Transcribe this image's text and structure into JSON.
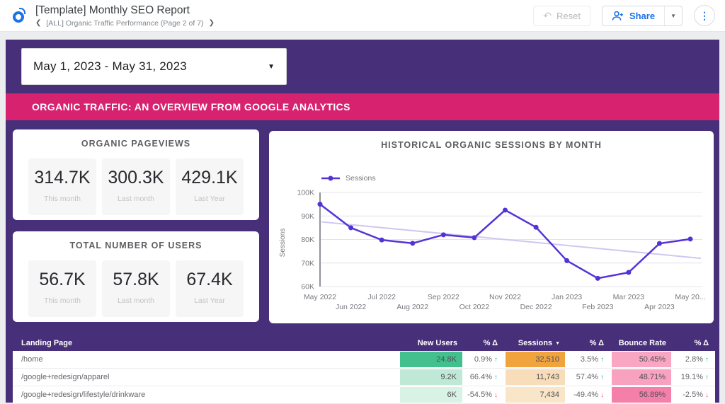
{
  "header": {
    "title": "[Template] Monthly SEO Report",
    "breadcrumb": "[ALL] Organic Traffic Performance (Page 2 of 7)",
    "prev_icon": "❮",
    "next_icon": "❯",
    "reset_label": "Reset",
    "share_label": "Share",
    "share_caret": "▼",
    "more_icon": "⋮",
    "undo_icon": "↶"
  },
  "filters": {
    "date_range": "May 1, 2023 - May 31, 2023",
    "caret": "▼"
  },
  "banner": {
    "title": "ORGANIC TRAFFIC: AN OVERVIEW FROM GOOGLE ANALYTICS"
  },
  "colors": {
    "dashboard_purple": "#472f7a",
    "banner_pink": "#d6226f",
    "link_blue": "#1a73e8",
    "delta_up_green": "#1fae93",
    "delta_down_red": "#e8536a"
  },
  "scorecards": [
    {
      "title": "ORGANIC PAGEVIEWS",
      "items": [
        {
          "value": "314.7K",
          "label": "This month"
        },
        {
          "value": "300.3K",
          "label": "Last month"
        },
        {
          "value": "429.1K",
          "label": "Last Year"
        }
      ]
    },
    {
      "title": "TOTAL NUMBER OF USERS",
      "items": [
        {
          "value": "56.7K",
          "label": "This month"
        },
        {
          "value": "57.8K",
          "label": "Last month"
        },
        {
          "value": "67.4K",
          "label": "Last Year"
        }
      ]
    }
  ],
  "chart_data": {
    "type": "line",
    "title": "HISTORICAL ORGANIC SESSIONS BY MONTH",
    "ylabel": "Sessions",
    "legend": [
      "Sessions"
    ],
    "legend_position": "top-left",
    "grid": true,
    "ylim": [
      60000,
      100000
    ],
    "ytick_step": 10000,
    "yticks": [
      "60K",
      "70K",
      "80K",
      "90K",
      "100K"
    ],
    "x": [
      "May 2022",
      "Jun 2022",
      "Jul 2022",
      "Aug 2022",
      "Sep 2022",
      "Oct 2022",
      "Nov 2022",
      "Dec 2022",
      "Jan 2023",
      "Feb 2023",
      "Mar 2023",
      "Apr 2023",
      "May 20..."
    ],
    "series": [
      {
        "name": "Sessions",
        "values": [
          95000,
          85000,
          79800,
          78400,
          82000,
          80800,
          92500,
          85200,
          71000,
          63500,
          66000,
          78300,
          80200
        ],
        "color": "#5433d6"
      }
    ],
    "trendline": {
      "start": 87500,
      "end": 72000,
      "color": "#cfc7f0"
    },
    "axis_color": "#8f9399",
    "grid_color": "#e4e4e9",
    "tick_color": "#77797e"
  },
  "table": {
    "columns": [
      {
        "label": "Landing Page",
        "sort": false
      },
      {
        "label": "New Users",
        "sort": false
      },
      {
        "label": "% Δ",
        "sort": false
      },
      {
        "label": "Sessions",
        "sort": true
      },
      {
        "label": "% Δ",
        "sort": false
      },
      {
        "label": "Bounce Rate",
        "sort": false
      },
      {
        "label": "% Δ",
        "sort": false
      }
    ],
    "sort_caret": "▼",
    "rows": [
      {
        "page": "/home",
        "new_users": {
          "value": "24.8K",
          "bg": "#44c08e"
        },
        "new_users_delta": {
          "value": "0.9%",
          "dir": "up"
        },
        "sessions": {
          "value": "32,510",
          "bg": "#f1a43e"
        },
        "sessions_delta": {
          "value": "3.5%",
          "dir": "up"
        },
        "bounce_rate": {
          "value": "50.45%",
          "bg": "#f9a6c3"
        },
        "bounce_delta": {
          "value": "2.8%",
          "dir": "up"
        }
      },
      {
        "page": "/google+redesign/apparel",
        "new_users": {
          "value": "9.2K",
          "bg": "#bfe9d6"
        },
        "new_users_delta": {
          "value": "66.4%",
          "dir": "up"
        },
        "sessions": {
          "value": "11,743",
          "bg": "#f8ddba"
        },
        "sessions_delta": {
          "value": "57.4%",
          "dir": "up"
        },
        "bounce_rate": {
          "value": "48.71%",
          "bg": "#f8a2c0"
        },
        "bounce_delta": {
          "value": "19.1%",
          "dir": "up"
        }
      },
      {
        "page": "/google+redesign/lifestyle/drinkware",
        "new_users": {
          "value": "6K",
          "bg": "#d8f2e5"
        },
        "new_users_delta": {
          "value": "-54.5%",
          "dir": "down"
        },
        "sessions": {
          "value": "7,434",
          "bg": "#f9e5c8"
        },
        "sessions_delta": {
          "value": "-49.4%",
          "dir": "down"
        },
        "bounce_rate": {
          "value": "56.89%",
          "bg": "#f480aa"
        },
        "bounce_delta": {
          "value": "-2.5%",
          "dir": "down"
        }
      }
    ]
  }
}
